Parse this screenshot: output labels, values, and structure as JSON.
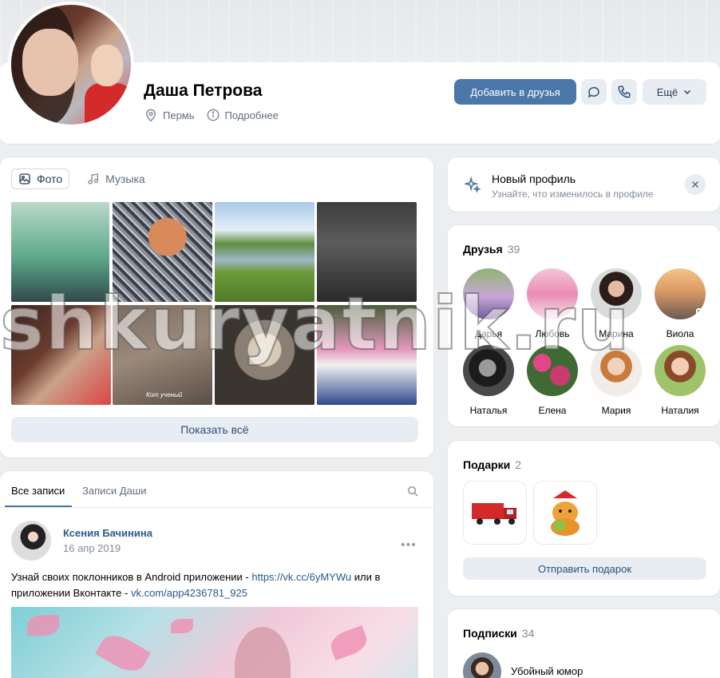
{
  "profile": {
    "name": "Даша Петрова",
    "city": "Пермь",
    "details_link": "Подробнее",
    "add_friend_label": "Добавить в друзья",
    "more_label": "Ещё"
  },
  "media": {
    "tabs": [
      {
        "label": "Фото",
        "icon": "photo-icon",
        "active": true
      },
      {
        "label": "Музыка",
        "icon": "music-note-icon",
        "active": false
      }
    ],
    "show_all_label": "Показать всё",
    "photo_caption": "Кот ученый"
  },
  "wall": {
    "tabs": [
      "Все записи",
      "Записи Даши"
    ],
    "post": {
      "author": "Ксения Бачинина",
      "date": "16 апр 2019",
      "text_1": "Узнай своих поклонников в Android приложении - ",
      "link_1": "https://vk.cc/6yMYWu",
      "text_2": " или в приложении Вконтакте - ",
      "link_2": "vk.com/app4236781_925"
    }
  },
  "new_profile": {
    "title": "Новый профиль",
    "subtitle": "Узнайте, что изменилось в профиле"
  },
  "friends": {
    "title": "Друзья",
    "count": "39",
    "items": [
      {
        "name": "Дарья"
      },
      {
        "name": "Любовь"
      },
      {
        "name": "Марина"
      },
      {
        "name": "Виола"
      },
      {
        "name": "Наталья"
      },
      {
        "name": "Елена"
      },
      {
        "name": "Мария"
      },
      {
        "name": "Наталия"
      }
    ]
  },
  "gifts": {
    "title": "Подарки",
    "count": "2",
    "send_label": "Отправить подарок"
  },
  "subscriptions": {
    "title": "Подписки",
    "count": "34",
    "first": "Убойный юмор"
  },
  "watermark": "shkuryatnik.ru",
  "colors": {
    "accent": "#4a76a8",
    "link": "#2a5885",
    "background": "#edeef0"
  }
}
